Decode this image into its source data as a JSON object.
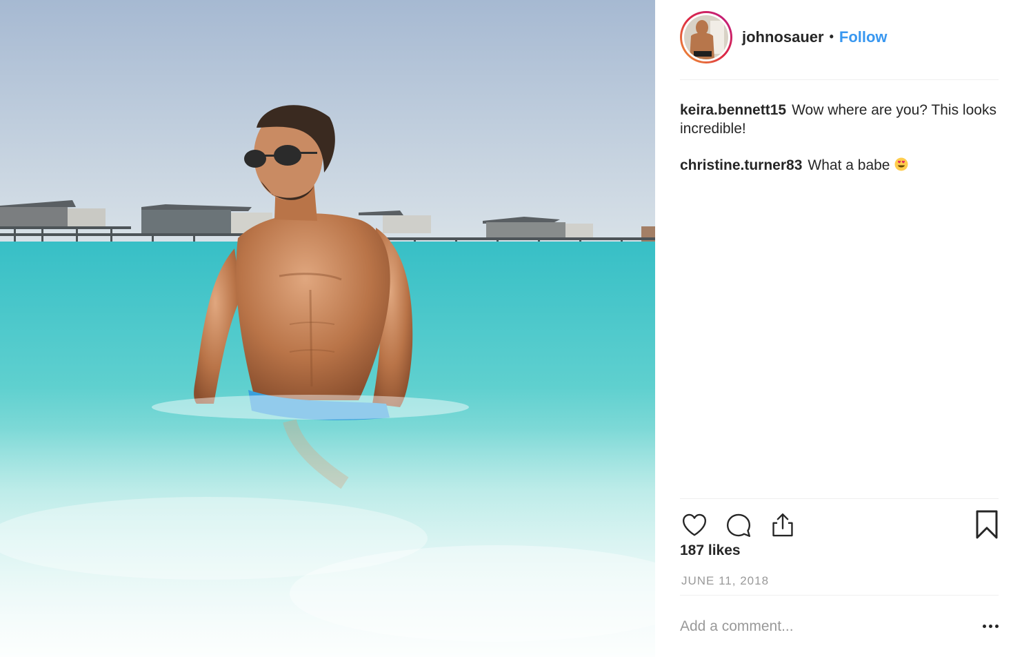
{
  "post": {
    "photo_icon": "beach-photo",
    "author": {
      "username": "johnosauer",
      "separator": "•",
      "follow_label": "Follow",
      "avatar_icon": "profile-avatar"
    },
    "comments": [
      {
        "username": "keira.bennett15",
        "text": "Wow where are you? This looks incredible!"
      },
      {
        "username": "christine.turner83",
        "text": "What a babe",
        "emoji": "heart-eyes-emoji"
      }
    ],
    "actions": {
      "like_icon": "heart-icon",
      "comment_icon": "comment-bubble-icon",
      "share_icon": "share-icon",
      "save_icon": "bookmark-icon"
    },
    "likes": "187 likes",
    "date": "JUNE 11, 2018",
    "comment_box": {
      "placeholder": "Add a comment...",
      "more_icon": "ellipsis-icon"
    }
  },
  "colors": {
    "accent": "#3897f0",
    "text": "#262626",
    "muted": "#999999",
    "divider": "#efefef"
  }
}
